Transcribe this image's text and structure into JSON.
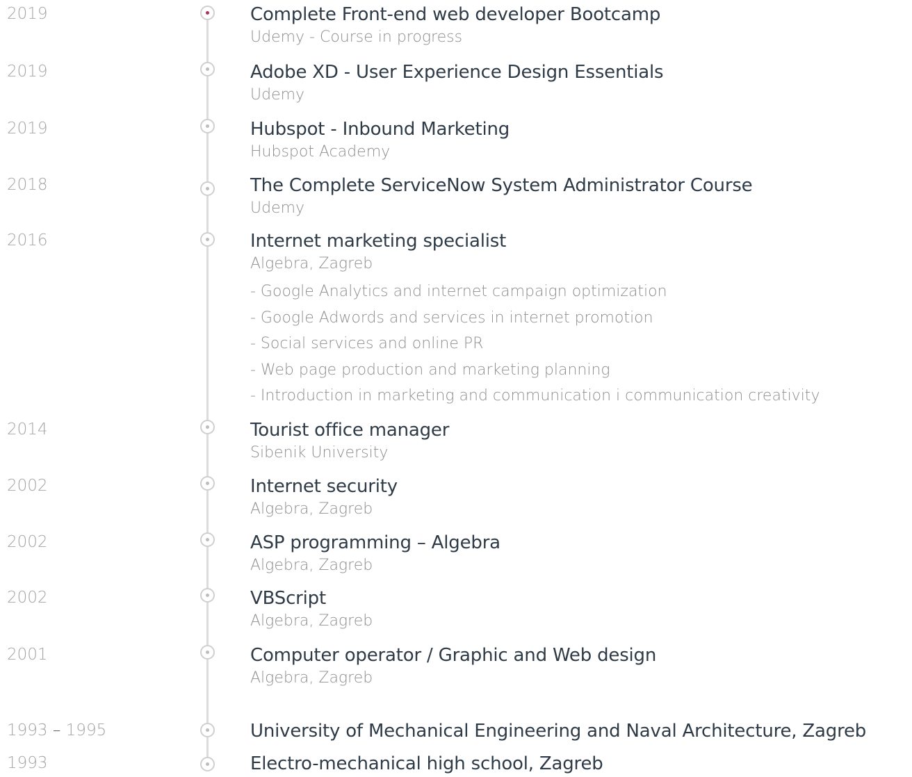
{
  "timeline": {
    "entries": [
      {
        "year": "2019",
        "title": "Complete Front-end web developer Bootcamp",
        "subtitle": "Udemy - Course in progress"
      },
      {
        "year": "2019",
        "title": "Adobe XD - User Experience Design Essentials",
        "subtitle": "Udemy"
      },
      {
        "year": "2019",
        "title": "Hubspot - Inbound Marketing",
        "subtitle": "Hubspot Academy"
      },
      {
        "year": "2018",
        "title": "The Complete ServiceNow System Administrator Course",
        "subtitle": "Udemy"
      },
      {
        "year": "2016",
        "title": "Internet marketing specialist",
        "subtitle": "Algebra, Zagreb",
        "details": [
          "- Google Analytics and internet campaign optimization",
          "- Google Adwords and services in internet promotion",
          "- Social services and online PR",
          "- Web page production and marketing planning",
          "- Introduction in marketing and communication i communication creativity"
        ]
      },
      {
        "year": "2014",
        "title": "Tourist office manager",
        "subtitle": "Sibenik University"
      },
      {
        "year": "2002",
        "title": "Internet security",
        "subtitle": "Algebra, Zagreb"
      },
      {
        "year": "2002",
        "title": "ASP programming – Algebra",
        "subtitle": "Algebra, Zagreb"
      },
      {
        "year": "2002",
        "title": "VBScript",
        "subtitle": "Algebra, Zagreb"
      },
      {
        "year": "2001",
        "title": "Computer operator / Graphic and Web design",
        "subtitle": "Algebra, Zagreb"
      },
      {
        "year_start": "1993",
        "year_sep": "–",
        "year_end": "1995",
        "title": "University of Mechanical Engineering and Naval Architecture, Zagreb"
      },
      {
        "year": "1993",
        "title": "Electro-mechanical high school, Zagreb"
      }
    ]
  },
  "colors": {
    "active_dot": "#b0305f",
    "dot": "#bdbdbd",
    "line": "#dcdcdc",
    "title": "#2e3a46",
    "muted": "#8e8e8e"
  },
  "icons": {
    "active": "circle-dot-icon-active",
    "default": "circle-dot-icon"
  }
}
